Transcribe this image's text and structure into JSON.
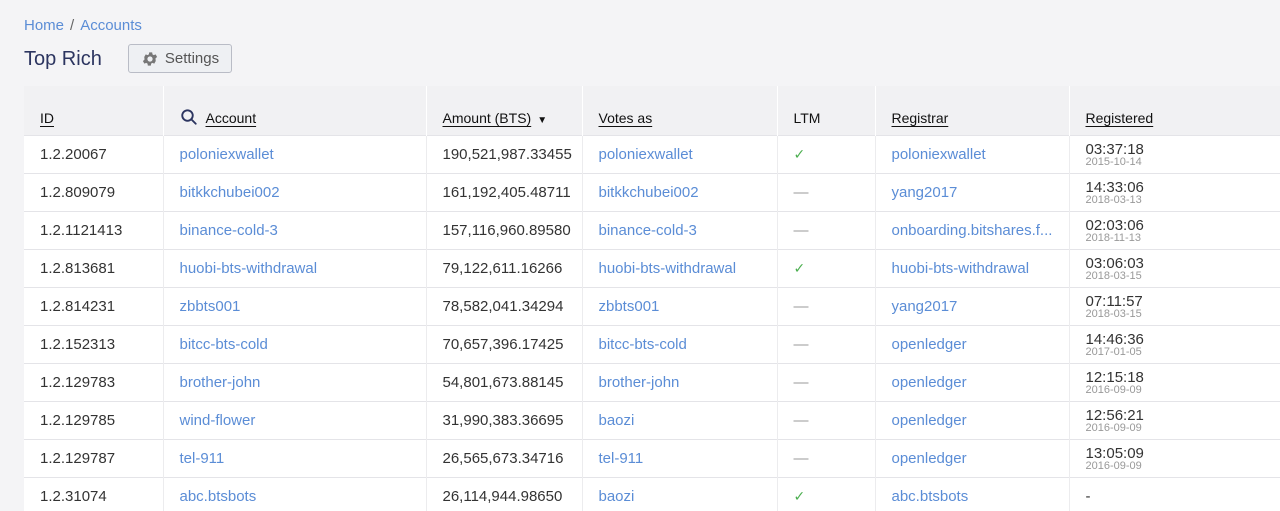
{
  "breadcrumb": {
    "home": "Home",
    "separator": "/",
    "current": "Accounts"
  },
  "page_title": "Top Rich",
  "settings_button": {
    "label": "Settings",
    "icon": "gear-icon"
  },
  "columns": {
    "id": "ID",
    "account": "Account",
    "amount": "Amount (BTS)",
    "votes_as": "Votes as",
    "ltm": "LTM",
    "registrar": "Registrar",
    "registered": "Registered"
  },
  "sort_indicator": "▼",
  "ltm_yes": "✓",
  "ltm_no": "—",
  "rows": [
    {
      "id": "1.2.20067",
      "account": "poloniexwallet",
      "amount": "190,521,987.33455",
      "votes_as": "poloniexwallet",
      "ltm": true,
      "registrar": "poloniexwallet",
      "time": "03:37:18",
      "date": "2015-10-14"
    },
    {
      "id": "1.2.809079",
      "account": "bitkkchubei002",
      "amount": "161,192,405.48711",
      "votes_as": "bitkkchubei002",
      "ltm": false,
      "registrar": "yang2017",
      "time": "14:33:06",
      "date": "2018-03-13"
    },
    {
      "id": "1.2.1121413",
      "account": "binance-cold-3",
      "amount": "157,116,960.89580",
      "votes_as": "binance-cold-3",
      "ltm": false,
      "registrar": "onboarding.bitshares.f...",
      "time": "02:03:06",
      "date": "2018-11-13"
    },
    {
      "id": "1.2.813681",
      "account": "huobi-bts-withdrawal",
      "amount": "79,122,611.16266",
      "votes_as": "huobi-bts-withdrawal",
      "ltm": true,
      "registrar": "huobi-bts-withdrawal",
      "time": "03:06:03",
      "date": "2018-03-15"
    },
    {
      "id": "1.2.814231",
      "account": "zbbts001",
      "amount": "78,582,041.34294",
      "votes_as": "zbbts001",
      "ltm": false,
      "registrar": "yang2017",
      "time": "07:11:57",
      "date": "2018-03-15"
    },
    {
      "id": "1.2.152313",
      "account": "bitcc-bts-cold",
      "amount": "70,657,396.17425",
      "votes_as": "bitcc-bts-cold",
      "ltm": false,
      "registrar": "openledger",
      "time": "14:46:36",
      "date": "2017-01-05"
    },
    {
      "id": "1.2.129783",
      "account": "brother-john",
      "amount": "54,801,673.88145",
      "votes_as": "brother-john",
      "ltm": false,
      "registrar": "openledger",
      "time": "12:15:18",
      "date": "2016-09-09"
    },
    {
      "id": "1.2.129785",
      "account": "wind-flower",
      "amount": "31,990,383.36695",
      "votes_as": "baozi",
      "ltm": false,
      "registrar": "openledger",
      "time": "12:56:21",
      "date": "2016-09-09"
    },
    {
      "id": "1.2.129787",
      "account": "tel-911",
      "amount": "26,565,673.34716",
      "votes_as": "tel-911",
      "ltm": false,
      "registrar": "openledger",
      "time": "13:05:09",
      "date": "2016-09-09"
    },
    {
      "id": "1.2.31074",
      "account": "abc.btsbots",
      "amount": "26,114,944.98650",
      "votes_as": "baozi",
      "ltm": true,
      "registrar": "abc.btsbots",
      "time": "-",
      "date": ""
    }
  ]
}
